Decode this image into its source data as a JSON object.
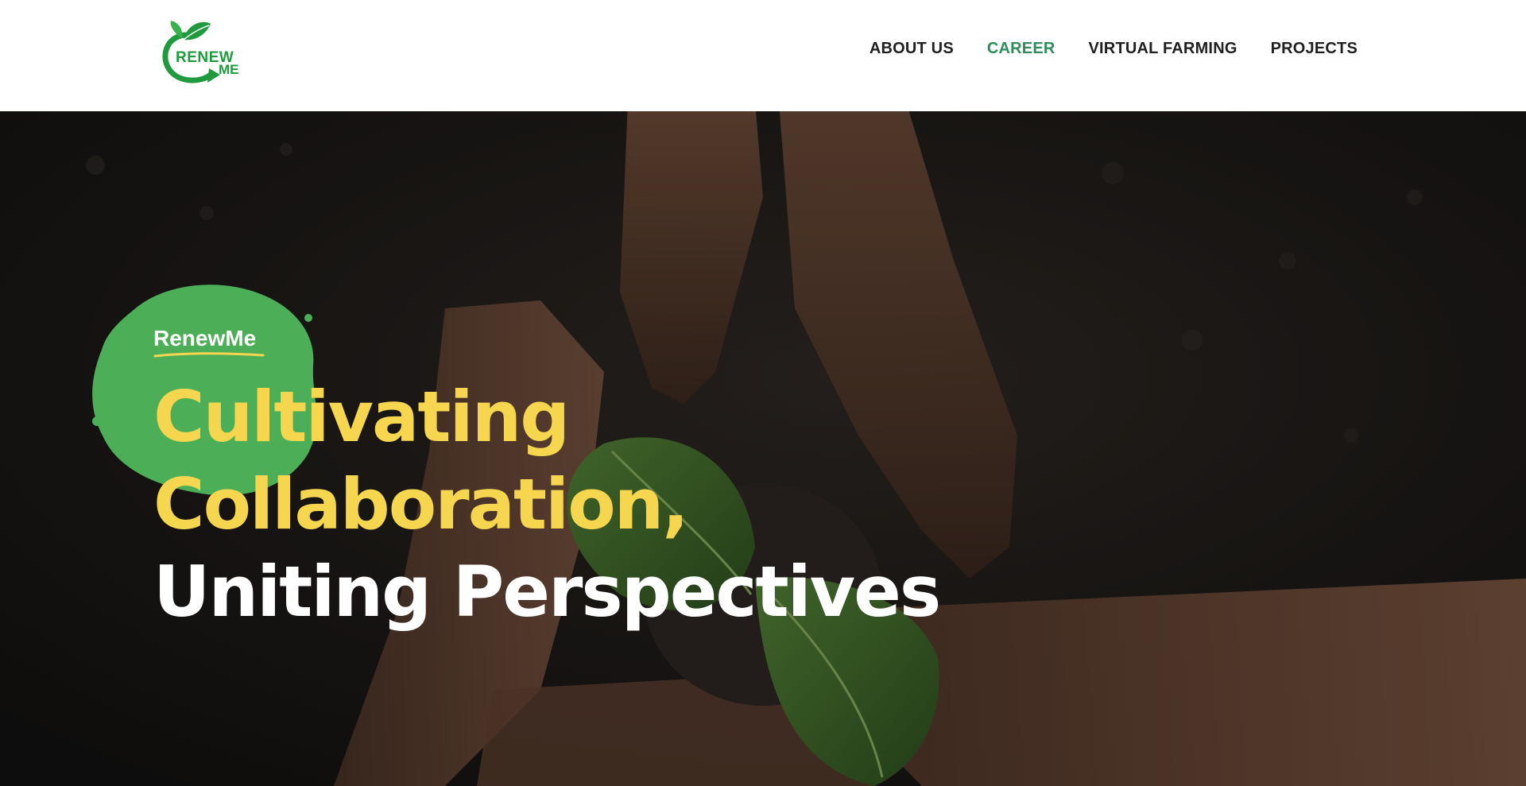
{
  "header": {
    "logo": {
      "text_top": "RENEW",
      "text_bottom": "ME",
      "icon": "leaf-cycle-icon",
      "color": "#1f9a3c"
    },
    "nav": [
      {
        "label": "ABOUT US",
        "active": false
      },
      {
        "label": "CAREER",
        "active": true
      },
      {
        "label": "VIRTUAL FARMING",
        "active": false
      },
      {
        "label": "PROJECTS",
        "active": false
      }
    ],
    "active_color": "#2e8d5a"
  },
  "hero": {
    "kicker": "RenewMe",
    "headline_line1": "Cultivating",
    "headline_line2": "Collaboration,",
    "headline_line3": "Uniting Perspectives",
    "accent_yellow": "#f6d54f",
    "blob_color": "#4caf57",
    "background_image": "hands-around-seedling-photo"
  }
}
